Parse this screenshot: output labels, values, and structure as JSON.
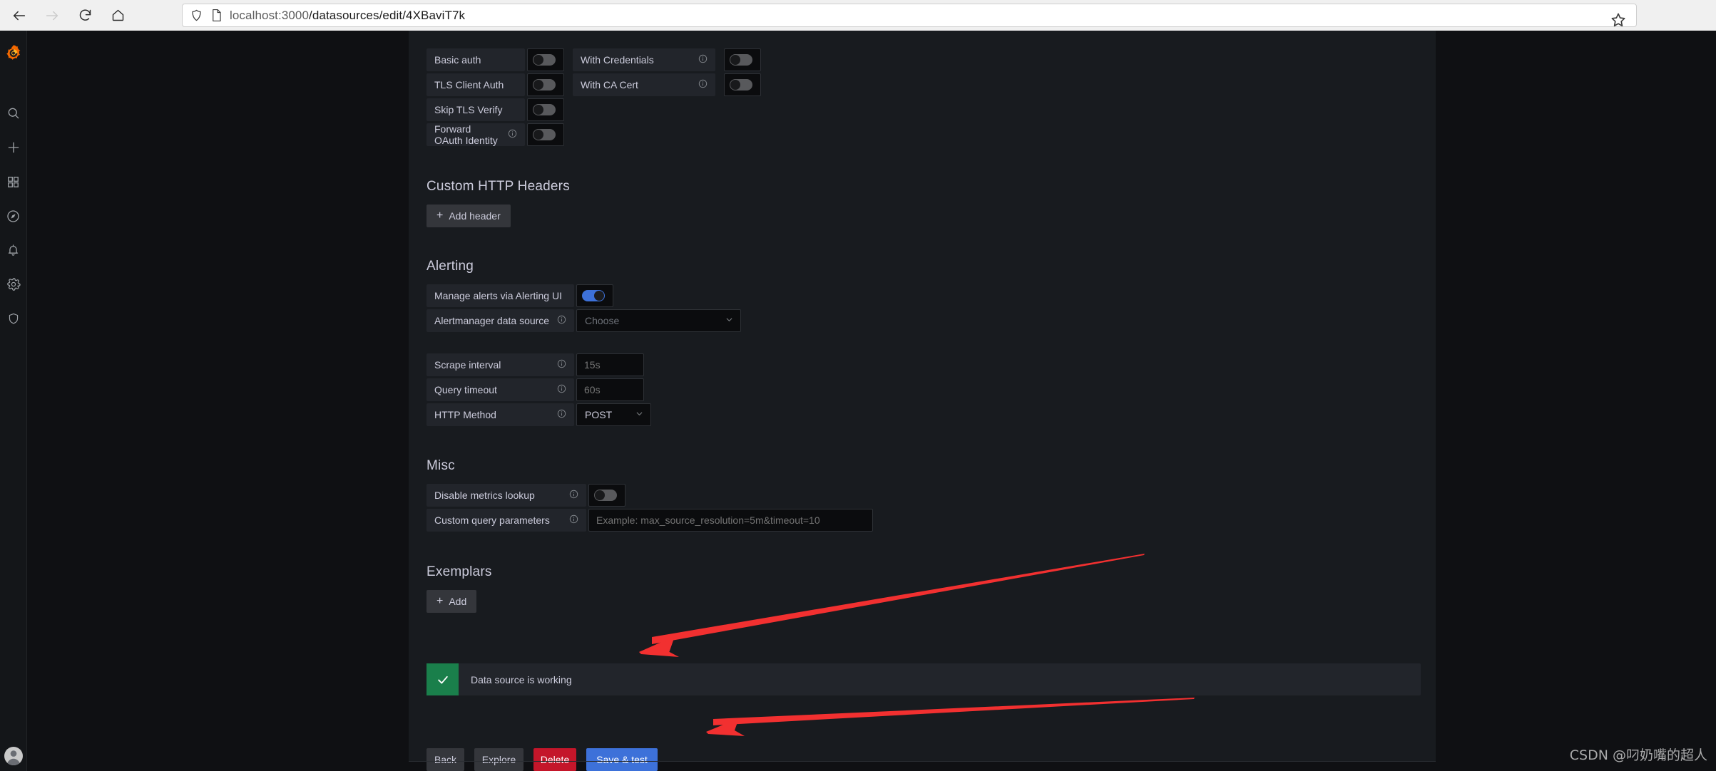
{
  "browser": {
    "back_icon": "back-arrow-icon",
    "forward_icon": "forward-arrow-icon",
    "reload_icon": "reload-icon",
    "home_icon": "home-icon",
    "shield_icon": "shield-icon",
    "page_icon": "page-icon",
    "bookmark_icon": "star-icon",
    "url_host": "localhost:3000",
    "url_path": "/datasources/edit/4XBaviT7k"
  },
  "sidebar": {
    "brand": "grafana-logo",
    "items": [
      {
        "name": "search-icon"
      },
      {
        "name": "create-icon"
      },
      {
        "name": "dashboards-icon"
      },
      {
        "name": "explore-icon"
      },
      {
        "name": "alerting-icon"
      },
      {
        "name": "configuration-icon"
      },
      {
        "name": "server-admin-icon"
      }
    ],
    "avatar": "user-avatar"
  },
  "auth": {
    "rows": [
      {
        "label": "Basic auth",
        "has_info": false,
        "toggle": "off"
      },
      {
        "label": "TLS Client Auth",
        "has_info": false,
        "toggle": "off"
      },
      {
        "label": "Skip TLS Verify",
        "has_info": false,
        "toggle": "off"
      },
      {
        "label": "Forward OAuth Identity",
        "has_info": true,
        "toggle": "off"
      }
    ],
    "rows_right": [
      {
        "label": "With Credentials",
        "has_info": true,
        "toggle": "off"
      },
      {
        "label": "With CA Cert",
        "has_info": true,
        "toggle": "off"
      }
    ]
  },
  "http_headers": {
    "title": "Custom HTTP Headers",
    "add_button": "Add header",
    "plus": "+"
  },
  "alerting": {
    "title": "Alerting",
    "manage_label": "Manage alerts via Alerting UI",
    "manage_toggle": "on",
    "alertmanager_label": "Alertmanager data source",
    "alertmanager_value": "Choose"
  },
  "scrape": {
    "rows": [
      {
        "label": "Scrape interval",
        "placeholder": "15s"
      },
      {
        "label": "Query timeout",
        "placeholder": "60s"
      }
    ],
    "http_method_label": "HTTP Method",
    "http_method_value": "POST"
  },
  "misc": {
    "title": "Misc",
    "disable_metrics_label": "Disable metrics lookup",
    "disable_metrics_toggle": "off",
    "custom_query_label": "Custom query parameters",
    "custom_query_placeholder": "Example: max_source_resolution=5m&timeout=10"
  },
  "exemplars": {
    "title": "Exemplars",
    "add_button": "Add",
    "plus": "+"
  },
  "status": {
    "icon": "check-icon",
    "message": "Data source is working",
    "color": "#1a7f4b"
  },
  "footer": {
    "back": "Back",
    "explore": "Explore",
    "delete": "Delete",
    "save_test": "Save & test"
  },
  "annotations": {
    "arrow_1": "points-to-status-alert",
    "arrow_2": "points-to-save-and-test-button",
    "color": "#f23030"
  },
  "watermark": "CSDN @叼奶嘴的超人"
}
